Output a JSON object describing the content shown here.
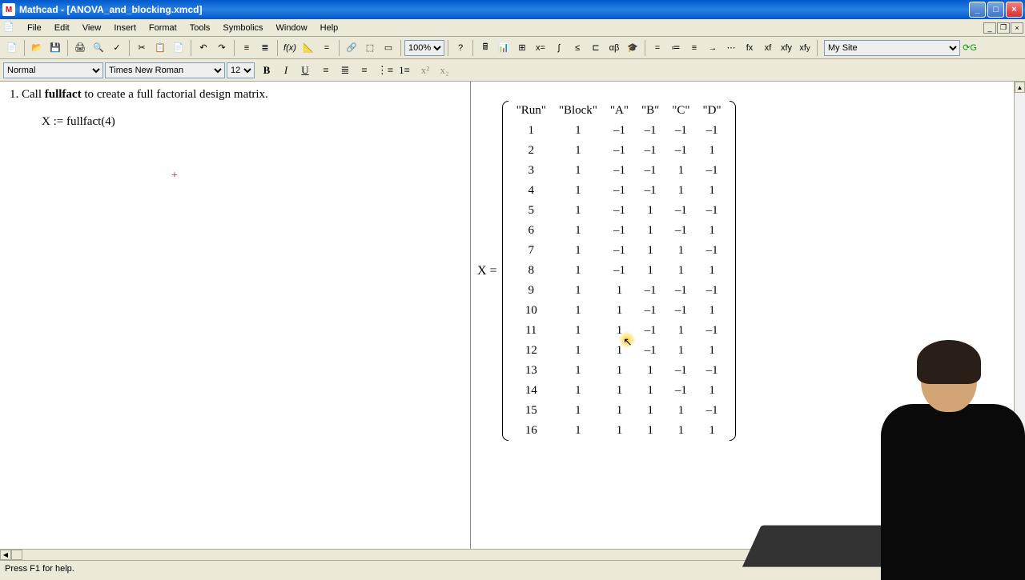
{
  "title": "Mathcad - [ANOVA_and_blocking.xmcd]",
  "menus": [
    "File",
    "Edit",
    "View",
    "Insert",
    "Format",
    "Tools",
    "Symbolics",
    "Window",
    "Help"
  ],
  "zoom": "100%",
  "site": "My Site",
  "style": "Normal",
  "font": "Times New Roman",
  "font_size": "12",
  "instruction_prefix": "1. Call ",
  "instruction_bold": "fullfact",
  "instruction_suffix": " to create a full factorial design matrix.",
  "equation": "X := fullfact(4)",
  "matrix_label": "X =",
  "matrix_headers": [
    "\"Run\"",
    "\"Block\"",
    "\"A\"",
    "\"B\"",
    "\"C\"",
    "\"D\""
  ],
  "matrix_rows": [
    [
      1,
      1,
      -1,
      -1,
      -1,
      -1
    ],
    [
      2,
      1,
      -1,
      -1,
      -1,
      1
    ],
    [
      3,
      1,
      -1,
      -1,
      1,
      -1
    ],
    [
      4,
      1,
      -1,
      -1,
      1,
      1
    ],
    [
      5,
      1,
      -1,
      1,
      -1,
      -1
    ],
    [
      6,
      1,
      -1,
      1,
      -1,
      1
    ],
    [
      7,
      1,
      -1,
      1,
      1,
      -1
    ],
    [
      8,
      1,
      -1,
      1,
      1,
      1
    ],
    [
      9,
      1,
      1,
      -1,
      -1,
      -1
    ],
    [
      10,
      1,
      1,
      -1,
      -1,
      1
    ],
    [
      11,
      1,
      1,
      -1,
      1,
      -1
    ],
    [
      12,
      1,
      1,
      -1,
      1,
      1
    ],
    [
      13,
      1,
      1,
      1,
      -1,
      -1
    ],
    [
      14,
      1,
      1,
      1,
      -1,
      1
    ],
    [
      15,
      1,
      1,
      1,
      1,
      -1
    ],
    [
      16,
      1,
      1,
      1,
      1,
      1
    ]
  ],
  "status": "Press F1 for help.",
  "toolbar_icons": [
    "new",
    "open",
    "save",
    "print",
    "preview",
    "spell",
    "cut",
    "copy",
    "paste",
    "undo",
    "redo",
    "align",
    "fx",
    "eval",
    "equals",
    "graph",
    "matrix",
    "region",
    "help"
  ],
  "math_icons": [
    "calc",
    "arith",
    "graph",
    "matrix",
    "eval",
    "calc2",
    "bool",
    "prog",
    "greek",
    "sym"
  ],
  "fmt_icons": {
    "b": "B",
    "i": "I",
    "u": "U"
  }
}
